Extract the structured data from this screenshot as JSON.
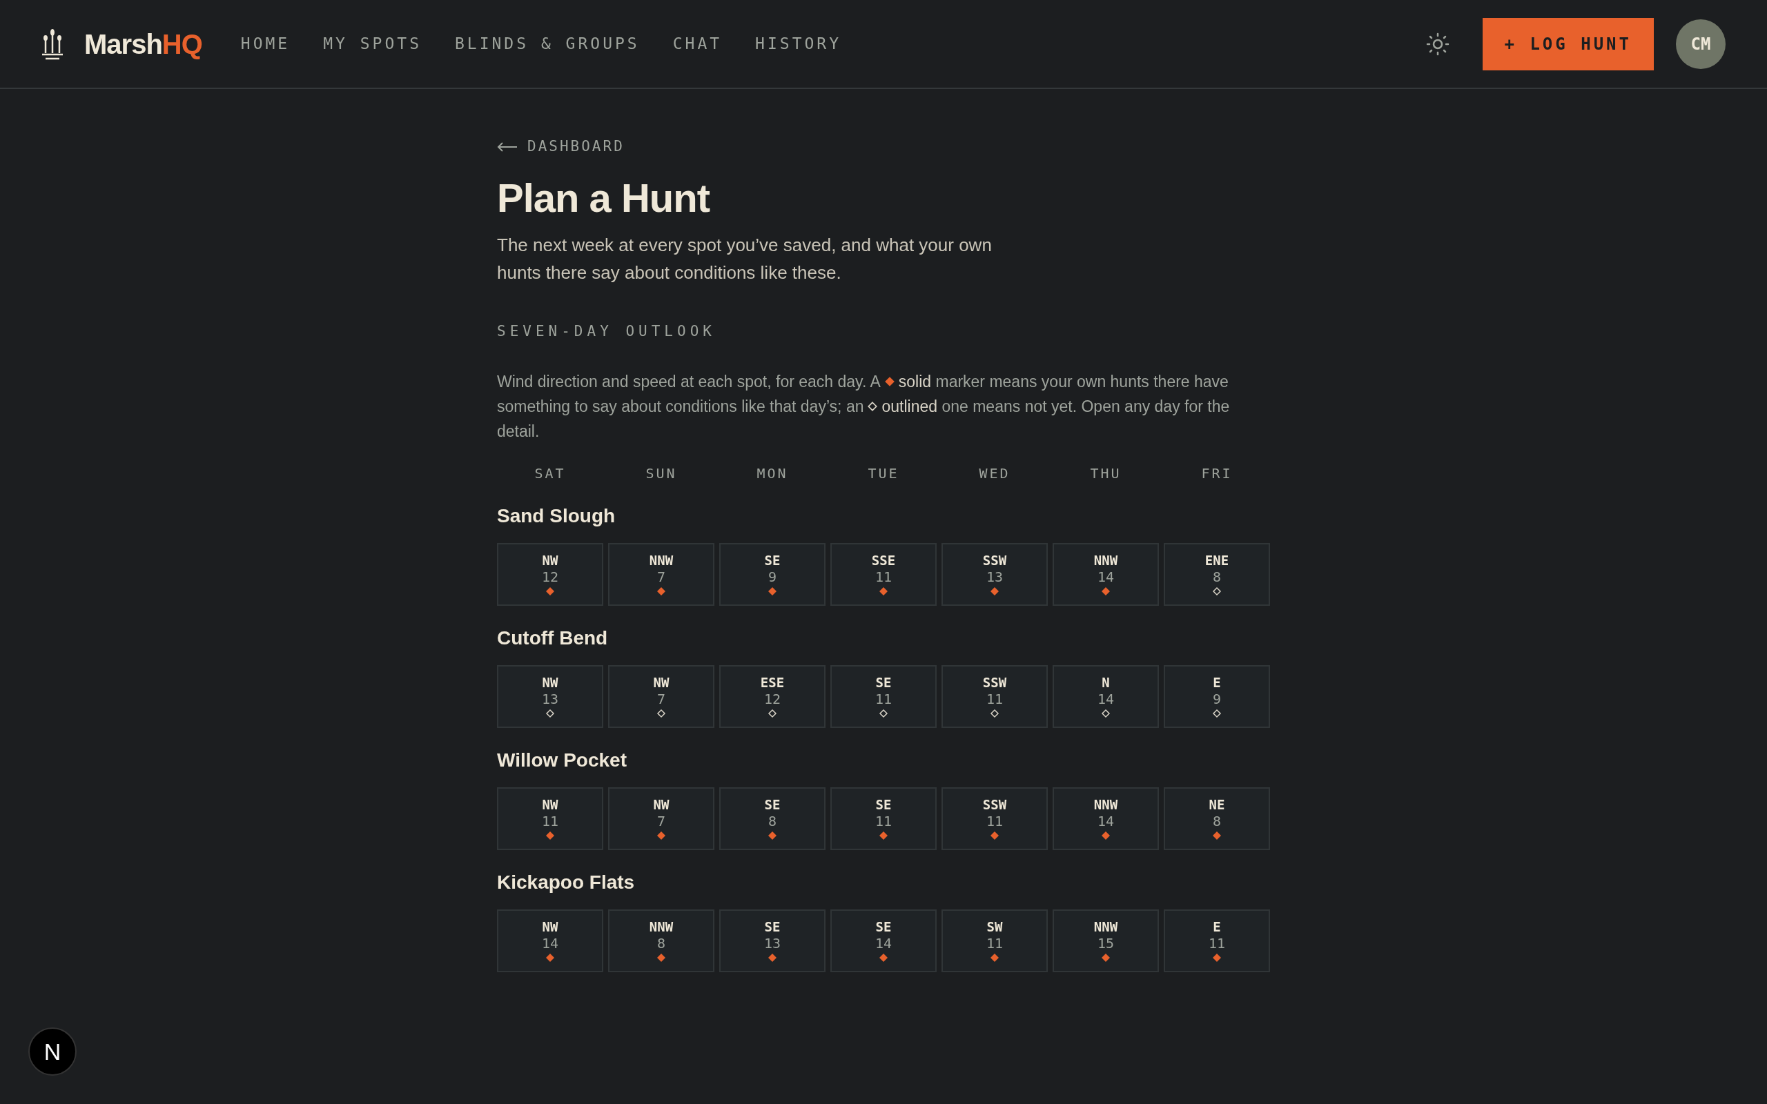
{
  "brand": {
    "name": "Marsh",
    "accent": "HQ"
  },
  "nav": [
    {
      "label": "HOME",
      "selected": false
    },
    {
      "label": "MY SPOTS",
      "selected": false
    },
    {
      "label": "BLINDS & GROUPS",
      "selected": false
    },
    {
      "label": "CHAT",
      "selected": false
    },
    {
      "label": "HISTORY",
      "selected": false
    }
  ],
  "log_button": "+ LOG HUNT",
  "avatar": "CM",
  "back_link": "DASHBOARD",
  "title": "Plan a Hunt",
  "subtitle": "The next week at every spot you’ve saved, and what your own hunts there say about conditions like these.",
  "section_label": "SEVEN-DAY OUTLOOK",
  "legend": [
    [
      {
        "kind": "text",
        "text": "Wind direction and speed at each spot, for each day. A"
      },
      {
        "kind": "marker",
        "logged": true
      },
      {
        "kind": "text",
        "text": "**solid** marker means your own hunts there have"
      }
    ],
    [
      {
        "kind": "text",
        "text": "something to say about conditions like that day’s; an"
      },
      {
        "kind": "marker",
        "logged": false
      },
      {
        "kind": "text",
        "text": "**outlined** one means not yet. Open any day for the"
      }
    ],
    [
      {
        "kind": "text",
        "text": "detail."
      }
    ]
  ],
  "days": [
    "SAT",
    "SUN",
    "MON",
    "TUE",
    "WED",
    "THU",
    "FRI"
  ],
  "spots": [
    {
      "name": "Sand Slough",
      "forecast": [
        {
          "dir": "NW",
          "speed": "12",
          "logged": true
        },
        {
          "dir": "NNW",
          "speed": "7",
          "logged": true
        },
        {
          "dir": "SE",
          "speed": "9",
          "logged": true
        },
        {
          "dir": "SSE",
          "speed": "11",
          "logged": true
        },
        {
          "dir": "SSW",
          "speed": "13",
          "logged": true
        },
        {
          "dir": "NNW",
          "speed": "14",
          "logged": true
        },
        {
          "dir": "ENE",
          "speed": "8",
          "logged": false
        }
      ]
    },
    {
      "name": "Cutoff Bend",
      "forecast": [
        {
          "dir": "NW",
          "speed": "13",
          "logged": false
        },
        {
          "dir": "NW",
          "speed": "7",
          "logged": false
        },
        {
          "dir": "ESE",
          "speed": "12",
          "logged": false
        },
        {
          "dir": "SE",
          "speed": "11",
          "logged": false
        },
        {
          "dir": "SSW",
          "speed": "11",
          "logged": false
        },
        {
          "dir": "N",
          "speed": "14",
          "logged": false
        },
        {
          "dir": "E",
          "speed": "9",
          "logged": false
        }
      ]
    },
    {
      "name": "Willow Pocket",
      "forecast": [
        {
          "dir": "NW",
          "speed": "11",
          "logged": true
        },
        {
          "dir": "NW",
          "speed": "7",
          "logged": true
        },
        {
          "dir": "SE",
          "speed": "8",
          "logged": true
        },
        {
          "dir": "SE",
          "speed": "11",
          "logged": true
        },
        {
          "dir": "SSW",
          "speed": "11",
          "logged": true
        },
        {
          "dir": "NNW",
          "speed": "14",
          "logged": true
        },
        {
          "dir": "NE",
          "speed": "8",
          "logged": true
        }
      ]
    },
    {
      "name": "Kickapoo Flats",
      "forecast": [
        {
          "dir": "NW",
          "speed": "14",
          "logged": true
        },
        {
          "dir": "NNW",
          "speed": "8",
          "logged": true
        },
        {
          "dir": "SE",
          "speed": "13",
          "logged": true
        },
        {
          "dir": "SE",
          "speed": "14",
          "logged": true
        },
        {
          "dir": "SW",
          "speed": "11",
          "logged": true
        },
        {
          "dir": "NNW",
          "speed": "15",
          "logged": true
        },
        {
          "dir": "E",
          "speed": "11",
          "logged": true
        }
      ]
    }
  ],
  "dev_badge": "N"
}
